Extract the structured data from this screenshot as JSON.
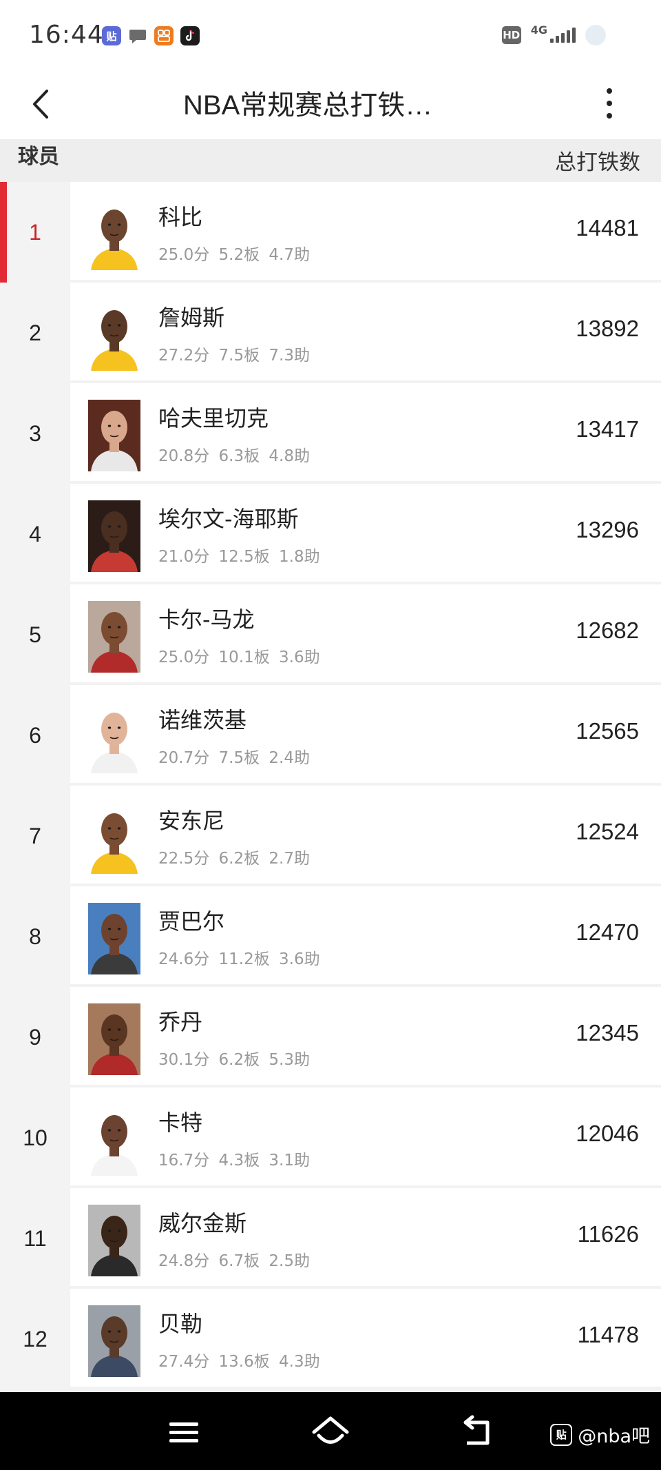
{
  "status_bar": {
    "time": "16:44",
    "notification_icons": [
      {
        "icon": "tieba-icon",
        "label": "贴",
        "color": "#5a6bd6"
      },
      {
        "icon": "chat-bubble-icon",
        "label": "",
        "color": "#6b6b6b"
      },
      {
        "icon": "app-orange-icon",
        "label": "",
        "color": "#f07b1e"
      },
      {
        "icon": "tiktok-icon",
        "label": "",
        "color": "#1c1c1c"
      }
    ],
    "hd_label": "HD",
    "network_type": "4G"
  },
  "header": {
    "title": "NBA常规赛总打铁…",
    "back_icon": "chevron-left-icon",
    "more_icon": "more-vertical-icon"
  },
  "columns": {
    "player": "球员",
    "stat": "总打铁数"
  },
  "colors": {
    "accent_red": "#e12b35",
    "rank_red": "#c8232c"
  },
  "players": [
    {
      "rank": "1",
      "name": "科比",
      "stats": "25.0分 5.2板 4.7助",
      "total": "14481",
      "jersey": "#f5c220",
      "skin": "#6b4530",
      "bg": "#ffffff"
    },
    {
      "rank": "2",
      "name": "詹姆斯",
      "stats": "27.2分 7.5板 7.3助",
      "total": "13892",
      "jersey": "#f5c220",
      "skin": "#5a3a26",
      "bg": "#ffffff"
    },
    {
      "rank": "3",
      "name": "哈夫里切克",
      "stats": "20.8分 6.3板 4.8助",
      "total": "13417",
      "jersey": "#e8e8e8",
      "skin": "#d9a88c",
      "bg": "#5b2b1f"
    },
    {
      "rank": "4",
      "name": "埃尔文-海耶斯",
      "stats": "21.0分 12.5板 1.8助",
      "total": "13296",
      "jersey": "#c73a33",
      "skin": "#4a2e20",
      "bg": "#2b1c17"
    },
    {
      "rank": "5",
      "name": "卡尔-马龙",
      "stats": "25.0分 10.1板 3.6助",
      "total": "12682",
      "jersey": "#b22b2b",
      "skin": "#7b4b32",
      "bg": "#b9a89b"
    },
    {
      "rank": "6",
      "name": "诺维茨基",
      "stats": "20.7分 7.5板 2.4助",
      "total": "12565",
      "jersey": "#f1f1f1",
      "skin": "#e1b49a",
      "bg": "#ffffff"
    },
    {
      "rank": "7",
      "name": "安东尼",
      "stats": "22.5分 6.2板 2.7助",
      "total": "12524",
      "jersey": "#f5c220",
      "skin": "#7a4d33",
      "bg": "#ffffff"
    },
    {
      "rank": "8",
      "name": "贾巴尔",
      "stats": "24.6分 11.2板 3.6助",
      "total": "12470",
      "jersey": "#3b3b3b",
      "skin": "#6d4330",
      "bg": "#4a7fbf"
    },
    {
      "rank": "9",
      "name": "乔丹",
      "stats": "30.1分 6.2板 5.3助",
      "total": "12345",
      "jersey": "#b02a2a",
      "skin": "#5a3522",
      "bg": "#a57a5c"
    },
    {
      "rank": "10",
      "name": "卡特",
      "stats": "16.7分 4.3板 3.1助",
      "total": "12046",
      "jersey": "#f4f4f4",
      "skin": "#6b4330",
      "bg": "#ffffff"
    },
    {
      "rank": "11",
      "name": "威尔金斯",
      "stats": "24.8分 6.7板 2.5助",
      "total": "11626",
      "jersey": "#2a2a2a",
      "skin": "#3a2519",
      "bg": "#b8b8b8"
    },
    {
      "rank": "12",
      "name": "贝勒",
      "stats": "27.4分 13.6板 4.3助",
      "total": "11478",
      "jersey": "#3d4a63",
      "skin": "#5a3a28",
      "bg": "#9aa0a8"
    }
  ],
  "nav_bar": {
    "menu_icon": "menu-icon",
    "home_icon": "home-icon",
    "back_icon": "back-arrow-icon"
  },
  "watermark": {
    "logo": "贴",
    "text": "@nba吧"
  }
}
